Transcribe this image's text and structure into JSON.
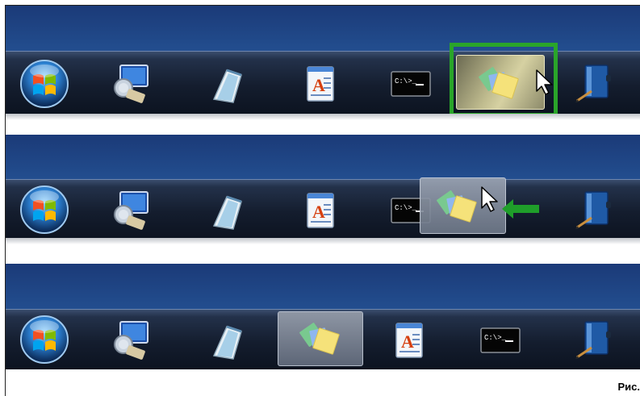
{
  "caption": "Рис. ",
  "icons": {
    "start": "windows-start-orb-icon",
    "computer": "remote-desktop-computer-icon",
    "notepad": "notepad-icon",
    "wordpad": "wordpad-icon",
    "cmd": "command-prompt-icon",
    "sticky": "sticky-notes-icon",
    "book": "address-book-icon",
    "cmd_text": "C:\\>_"
  },
  "panels": [
    {
      "name": "before-drag",
      "state": "sticky notes highlighted at the end"
    },
    {
      "name": "during-drag",
      "state": "sticky notes being dragged left"
    },
    {
      "name": "after-drop",
      "state": "sticky notes placed after notepad"
    }
  ],
  "colors": {
    "highlight": "#2aa52a",
    "arrow": "#1f9e2a",
    "desktop": "#204888",
    "taskbar": "#141d2e"
  }
}
